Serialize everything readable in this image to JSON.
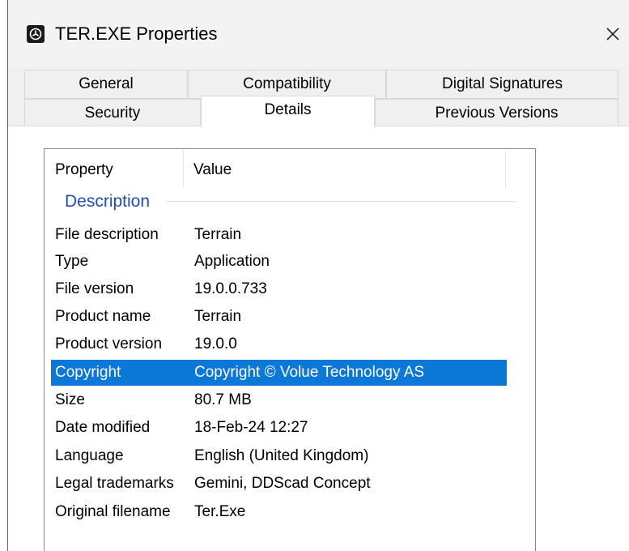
{
  "window": {
    "title": "TER.EXE Properties",
    "icon": "terrain-app-icon",
    "close_glyph": "✕"
  },
  "tabs": {
    "row_back": [
      {
        "label": "General"
      },
      {
        "label": "Compatibility"
      },
      {
        "label": "Digital Signatures"
      }
    ],
    "row_front": [
      {
        "label": "Security"
      },
      {
        "label": "Details",
        "active": true
      },
      {
        "label": "Previous Versions"
      }
    ]
  },
  "list": {
    "headers": {
      "property": "Property",
      "value": "Value"
    },
    "group": "Description",
    "rows": [
      {
        "property": "File description",
        "value": "Terrain"
      },
      {
        "property": "Type",
        "value": "Application"
      },
      {
        "property": "File version",
        "value": "19.0.0.733"
      },
      {
        "property": "Product name",
        "value": "Terrain"
      },
      {
        "property": "Product version",
        "value": "19.0.0"
      },
      {
        "property": "Copyright",
        "value": "Copyright © Volue Technology AS",
        "selected": true
      },
      {
        "property": "Size",
        "value": "80.7 MB"
      },
      {
        "property": "Date modified",
        "value": "18-Feb-24 12:27"
      },
      {
        "property": "Language",
        "value": "English (United Kingdom)"
      },
      {
        "property": "Legal trademarks",
        "value": "Gemini, DDScad Concept"
      },
      {
        "property": "Original filename",
        "value": "Ter.Exe"
      }
    ]
  },
  "colors": {
    "selection": "#0b78d7",
    "group_label": "#1f4fb4"
  }
}
